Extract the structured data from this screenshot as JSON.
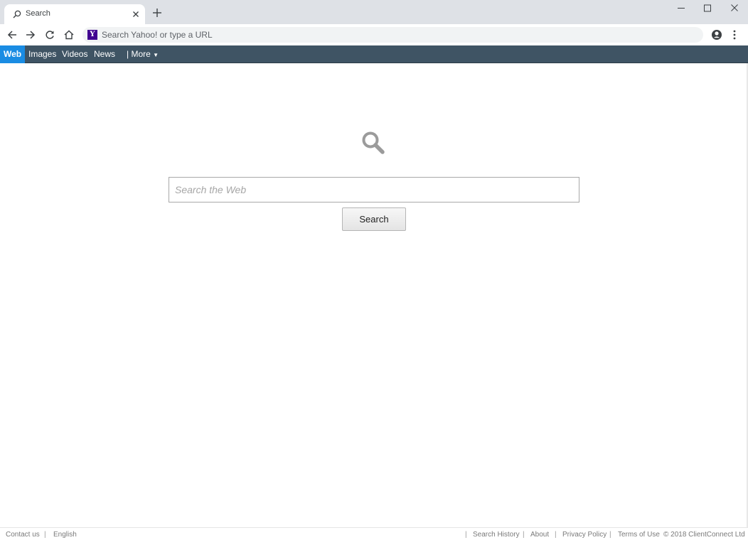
{
  "browser": {
    "tab_title": "Search",
    "omnibox_placeholder": "Search Yahoo! or type a URL",
    "omnibox_logo": "Y"
  },
  "nav": {
    "items": [
      {
        "label": "Web",
        "active": true
      },
      {
        "label": "Images"
      },
      {
        "label": "Videos"
      },
      {
        "label": "News"
      },
      {
        "label": "| More"
      }
    ]
  },
  "main": {
    "search_placeholder": "Search the Web",
    "search_button": "Search"
  },
  "footer": {
    "left": [
      "Contact us",
      "English"
    ],
    "right": [
      "Search History",
      "About",
      "Privacy Policy",
      "Terms of Use"
    ],
    "copyright": "© 2018 ClientConnect Ltd"
  },
  "colors": {
    "navbar": "#3f5464",
    "nav_active": "#1a8ce3",
    "yahoo_purple": "#400090"
  },
  "icons": [
    "search-icon",
    "close-icon",
    "plus-icon",
    "minimize-icon",
    "maximize-icon",
    "back-arrow-icon",
    "forward-arrow-icon",
    "reload-icon",
    "home-icon",
    "yahoo-logo-icon",
    "profile-icon",
    "kebab-menu-icon",
    "magnifier-icon",
    "caret-down-icon"
  ]
}
